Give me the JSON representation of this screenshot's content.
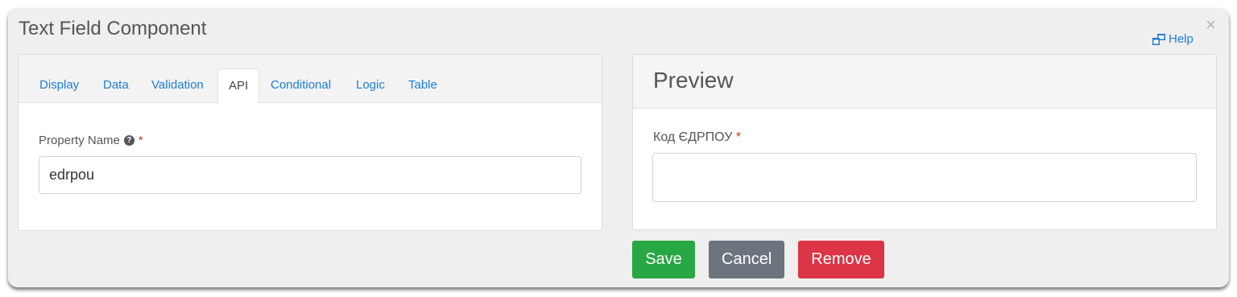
{
  "dialog": {
    "title": "Text Field Component",
    "close_symbol": "×",
    "help_label": "Help",
    "help_icon": "external-window-icon"
  },
  "settings": {
    "tabs": [
      "Display",
      "Data",
      "Validation",
      "API",
      "Conditional",
      "Logic",
      "Table"
    ],
    "active_tab": "API",
    "property_name_label": "Property Name",
    "required_marker": "*",
    "property_name_value": "edrpou"
  },
  "preview": {
    "title": "Preview",
    "field_label": "Код ЄДРПОУ",
    "required_marker": "*",
    "field_value": ""
  },
  "actions": {
    "save": "Save",
    "cancel": "Cancel",
    "remove": "Remove"
  },
  "colors": {
    "link": "#1e7dd6",
    "save": "#28a745",
    "cancel": "#6c757d",
    "remove": "#dc3545",
    "required": "#c0392b"
  }
}
